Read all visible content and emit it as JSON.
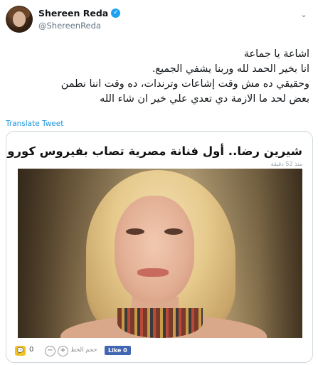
{
  "tweet": {
    "display_name": "Shereen Reda",
    "verified_mark": "✓",
    "handle": "@ShereenReda",
    "text_lines": [
      "اشاعة يا جماعة",
      "انا بخير الحمد لله وربنا يشفي الجميع.",
      "وحقيقي ده مش وقت إشاعات وترندات، ده وقت اننا نطمن",
      "بعض لحد ما الازمة دي تعدي علي خير ان شاء الله"
    ],
    "translate_label": "Translate Tweet"
  },
  "card": {
    "title": "شيرين رضا.. أول فنانة مصرية تصاب بفيروس كورونا",
    "time": "منذ 52 دقيقة",
    "footer": {
      "comment_count": "0",
      "font_size_label": "حجم الخط",
      "like_label": "Like 0",
      "zoom_out": "−",
      "zoom_in": "+"
    }
  },
  "icons": {
    "verified": "verified-badge-icon",
    "menu": "chevron-down-icon",
    "comment": "comment-icon",
    "like": "facebook-like-icon"
  },
  "colors": {
    "link": "#1b95e0",
    "verified": "#1da1f2",
    "like_button": "#4267b2"
  }
}
